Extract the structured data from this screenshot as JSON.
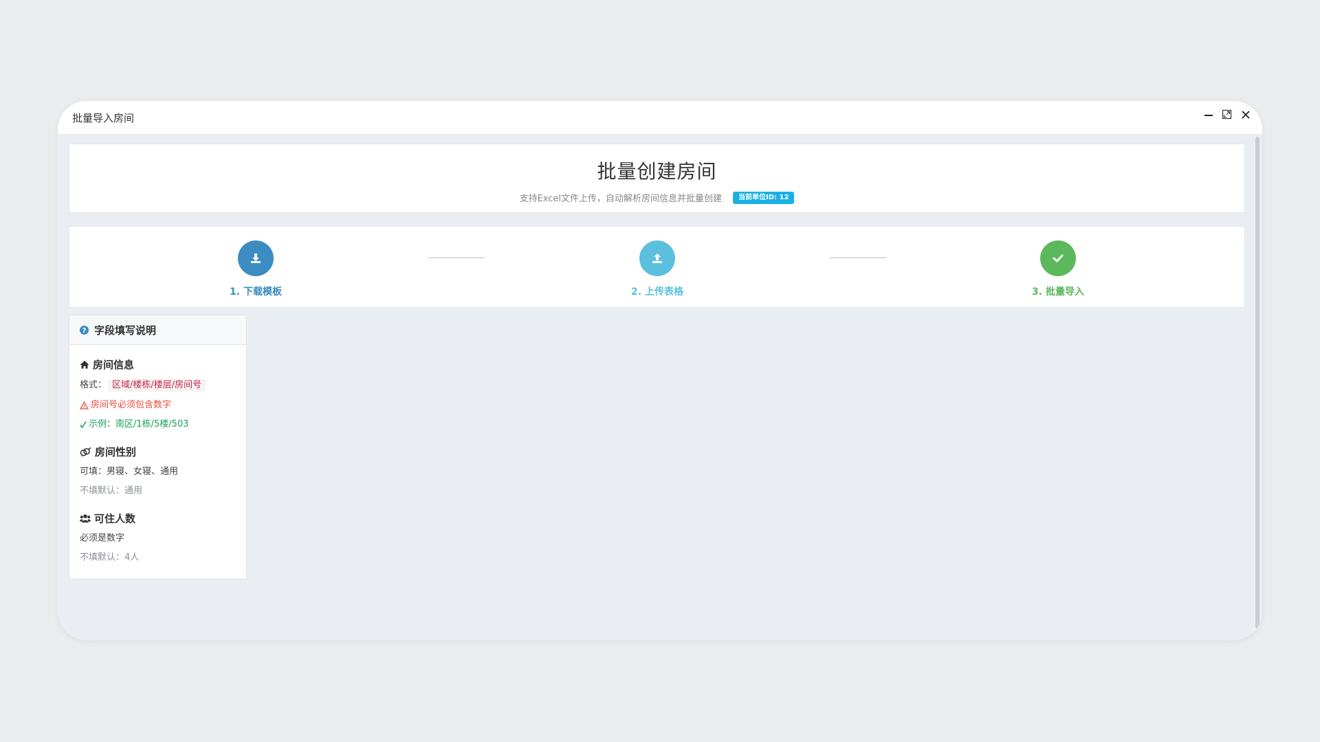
{
  "window": {
    "title": "批量导入房间"
  },
  "header": {
    "title": "批量创建房间",
    "subtitle": "支持Excel文件上传，自动解析房间信息并批量创建",
    "unit_badge": "当前单位ID: 12"
  },
  "steps": [
    {
      "label": "1. 下载模板",
      "icon": "download-icon",
      "color": "#3b8cc0"
    },
    {
      "label": "2. 上传表格",
      "icon": "upload-icon",
      "color": "#5bc0de"
    },
    {
      "label": "3. 批量导入",
      "icon": "check-icon",
      "color": "#5cb85c"
    }
  ],
  "help": {
    "title": "字段填写说明",
    "room_info": {
      "title": "房间信息",
      "format_label": "格式：",
      "format_value": "区域/楼栋/楼层/房间号",
      "warning": "房间号必须包含数字",
      "example": "示例：南区/1栋/5楼/503"
    },
    "room_gender": {
      "title": "房间性别",
      "options": "可填：男寝、女寝、通用",
      "default": "不填默认：通用"
    },
    "capacity": {
      "title": "可住人数",
      "rule": "必须是数字",
      "default": "不填默认：4人"
    }
  }
}
